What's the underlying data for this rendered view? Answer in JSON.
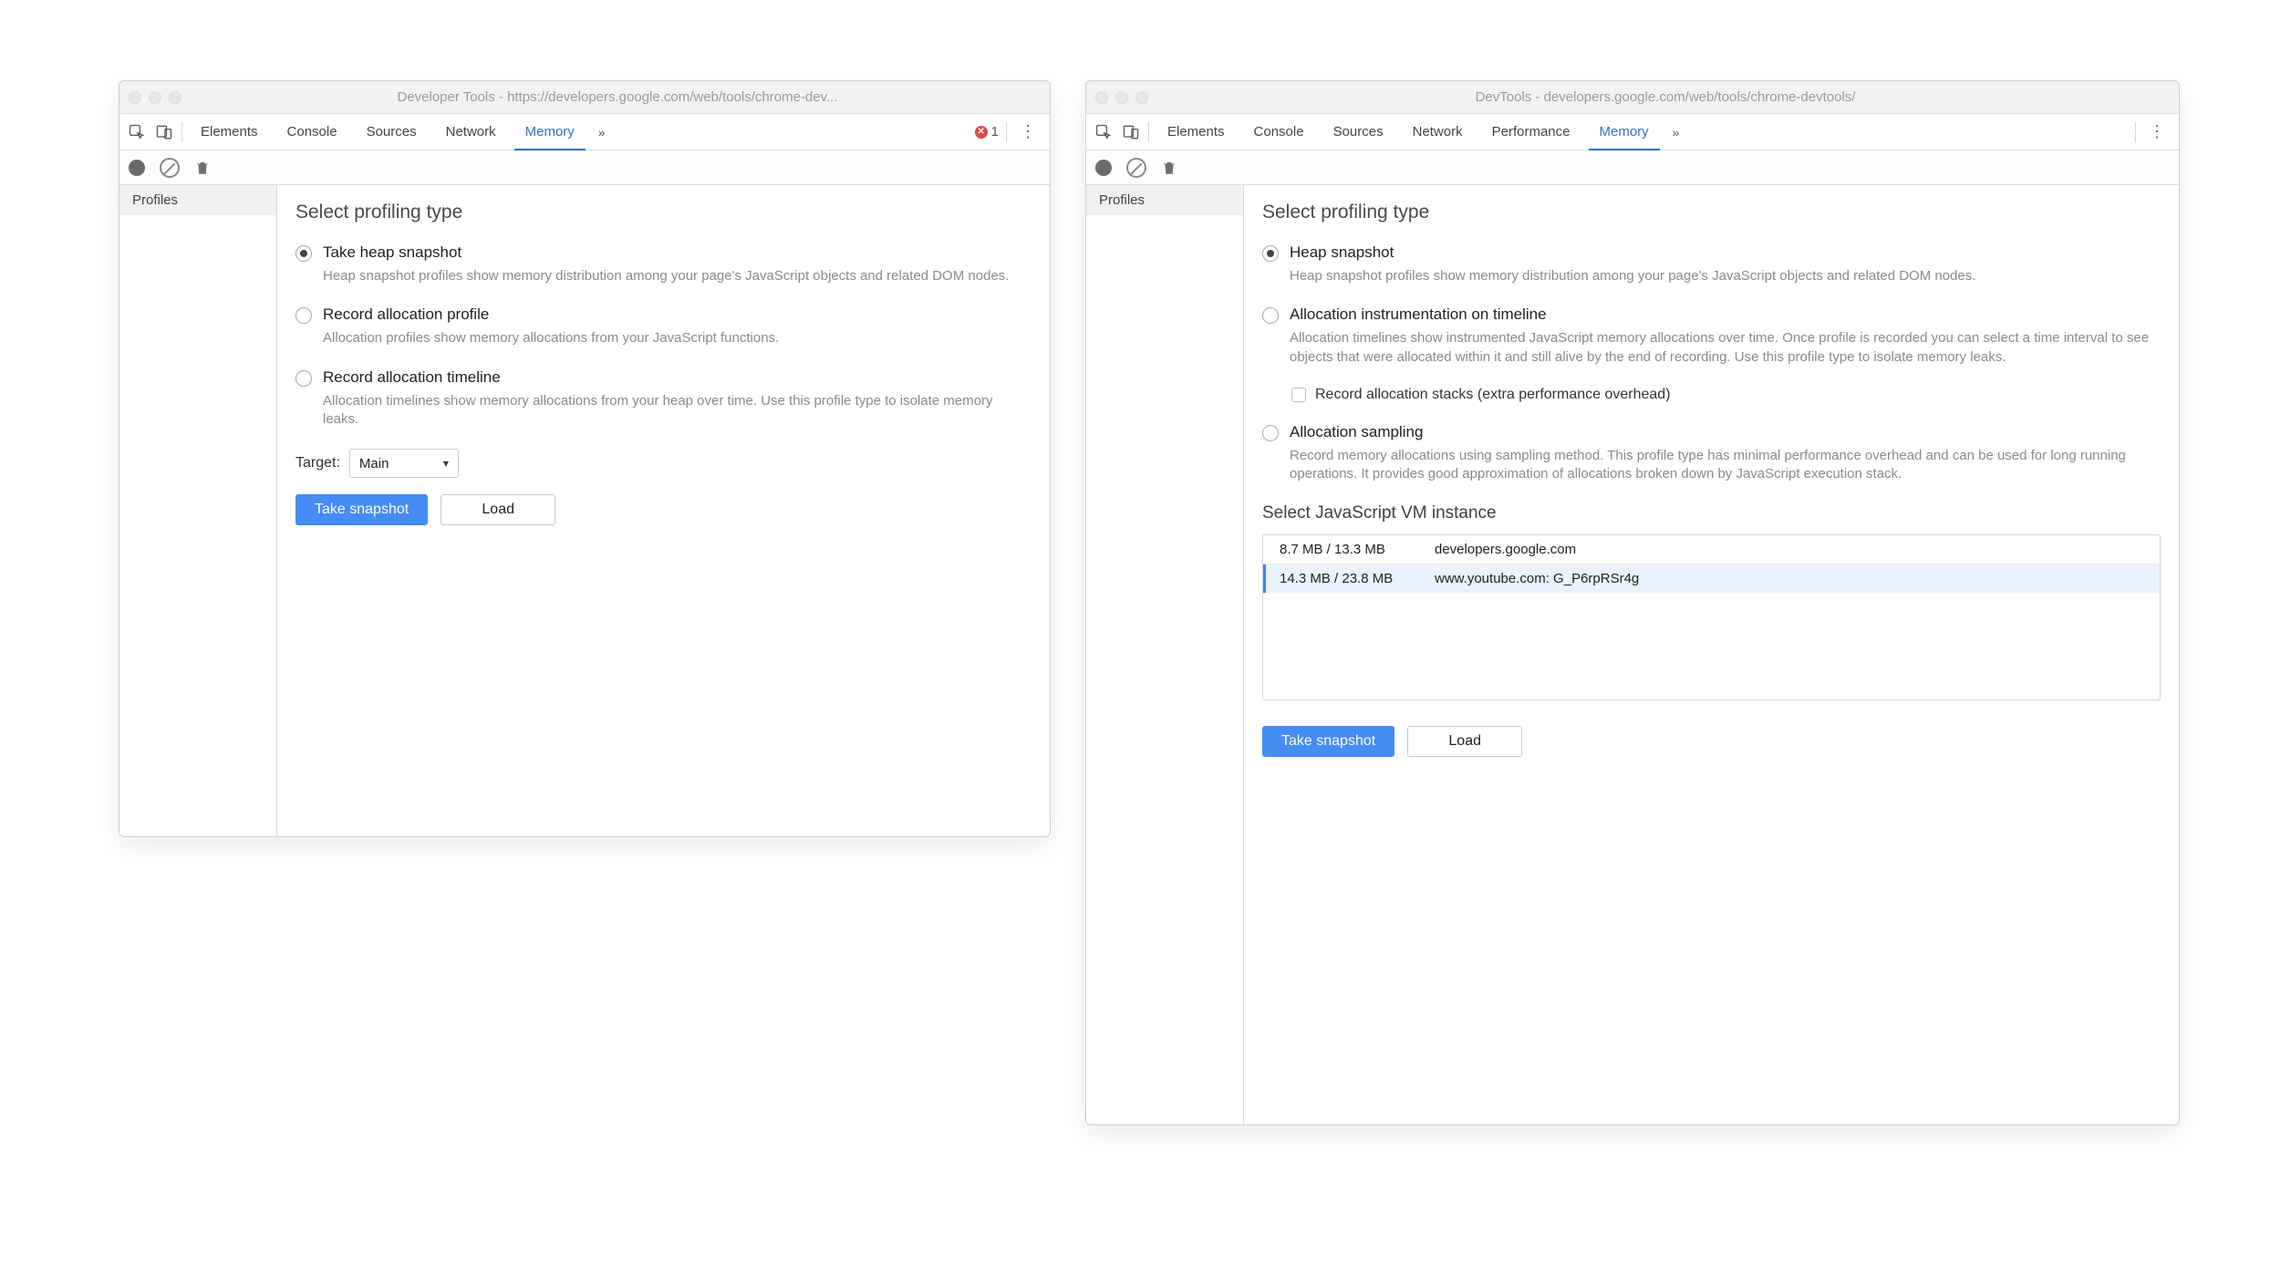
{
  "left": {
    "title": "Developer Tools - https://developers.google.com/web/tools/chrome-dev...",
    "tabs": [
      "Elements",
      "Console",
      "Sources",
      "Network",
      "Memory"
    ],
    "active_tab": "Memory",
    "error_count": "1",
    "sidebar_header": "Profiles",
    "heading": "Select profiling type",
    "options": [
      {
        "title": "Take heap snapshot",
        "desc": "Heap snapshot profiles show memory distribution among your page's JavaScript objects and related DOM nodes.",
        "checked": true
      },
      {
        "title": "Record allocation profile",
        "desc": "Allocation profiles show memory allocations from your JavaScript functions.",
        "checked": false
      },
      {
        "title": "Record allocation timeline",
        "desc": "Allocation timelines show memory allocations from your heap over time. Use this profile type to isolate memory leaks.",
        "checked": false
      }
    ],
    "target_label": "Target:",
    "target_value": "Main",
    "primary_btn": "Take snapshot",
    "secondary_btn": "Load"
  },
  "right": {
    "title": "DevTools - developers.google.com/web/tools/chrome-devtools/",
    "tabs": [
      "Elements",
      "Console",
      "Sources",
      "Network",
      "Performance",
      "Memory"
    ],
    "active_tab": "Memory",
    "sidebar_header": "Profiles",
    "heading": "Select profiling type",
    "options": [
      {
        "title": "Heap snapshot",
        "desc": "Heap snapshot profiles show memory distribution among your page's JavaScript objects and related DOM nodes.",
        "checked": true
      },
      {
        "title": "Allocation instrumentation on timeline",
        "desc": "Allocation timelines show instrumented JavaScript memory allocations over time. Once profile is recorded you can select a time interval to see objects that were allocated within it and still alive by the end of recording. Use this profile type to isolate memory leaks.",
        "checked": false,
        "sub_checkbox_label": "Record allocation stacks (extra performance overhead)"
      },
      {
        "title": "Allocation sampling",
        "desc": "Record memory allocations using sampling method. This profile type has minimal performance overhead and can be used for long running operations. It provides good approximation of allocations broken down by JavaScript execution stack.",
        "checked": false
      }
    ],
    "vm_heading": "Select JavaScript VM instance",
    "vm_rows": [
      {
        "mem": "8.7 MB / 13.3 MB",
        "origin": "developers.google.com",
        "selected": false
      },
      {
        "mem": "14.3 MB / 23.8 MB",
        "origin": "www.youtube.com: G_P6rpRSr4g",
        "selected": true
      }
    ],
    "primary_btn": "Take snapshot",
    "secondary_btn": "Load"
  }
}
